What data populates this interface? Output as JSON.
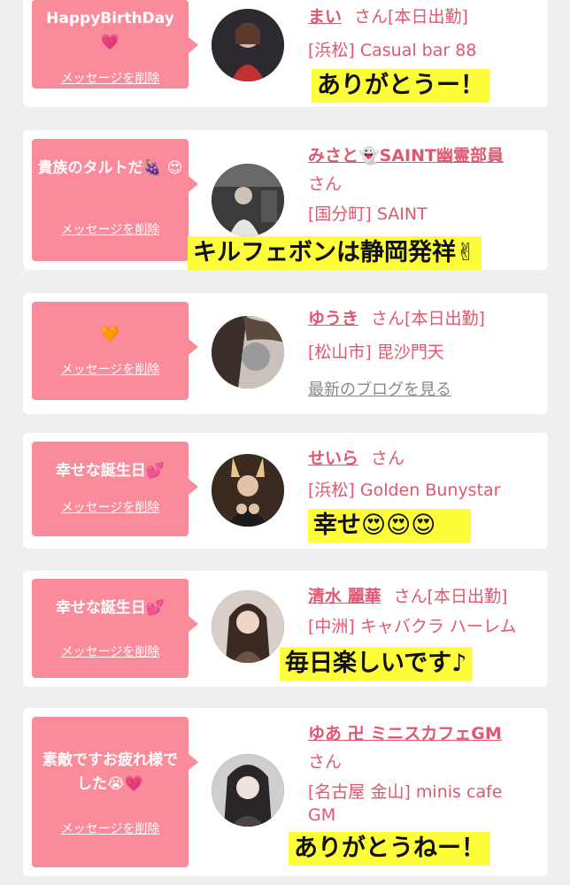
{
  "colors": {
    "page_bg": "#efefef",
    "card_bg": "#ffffff",
    "bubble_bg": "#f98b9b",
    "accent_text": "#e0576f",
    "caption_bg": "#fdfd3a",
    "muted_link": "#888888"
  },
  "delete_label": "メッセージを削除",
  "blog_label": "最新のブログを見る",
  "san_label": "さん",
  "messages": [
    {
      "text": "HappyBirthDay 💗",
      "name": "まい",
      "status": "[本日出勤]",
      "shop": "[浜松] Casual bar 88",
      "caption": "ありがとうー！"
    },
    {
      "text": "貴族のタルトだ🍇 😍",
      "name": "みさと👻SAINT幽霊部員",
      "status": "",
      "shop": "[国分町] SAINT",
      "caption": "キルフェボンは静岡発祥✌"
    },
    {
      "text": "🧡",
      "name": "ゆうき",
      "status": "[本日出勤]",
      "shop": "[松山市] 毘沙門天",
      "blog": "最新のブログを見る",
      "caption": ""
    },
    {
      "text": "幸せな誕生日💕",
      "name": "せいら",
      "status": "",
      "shop": "[浜松] Golden Bunystar",
      "caption": "幸せ😍😍😍"
    },
    {
      "text": "幸せな誕生日💕",
      "name": "清水 麗華",
      "status": "[本日出勤]",
      "shop": "[中洲] キャバクラ ハーレム",
      "caption": "毎日楽しいです♪"
    },
    {
      "text": "素敵ですお疲れ様でした😭💗",
      "name": "ゆあ 卍 ミニスカフェGM",
      "status": "",
      "shop_line1": "[名古屋 金山] minis cafe",
      "shop_line2": "GM",
      "caption": "ありがとうねー！"
    }
  ]
}
